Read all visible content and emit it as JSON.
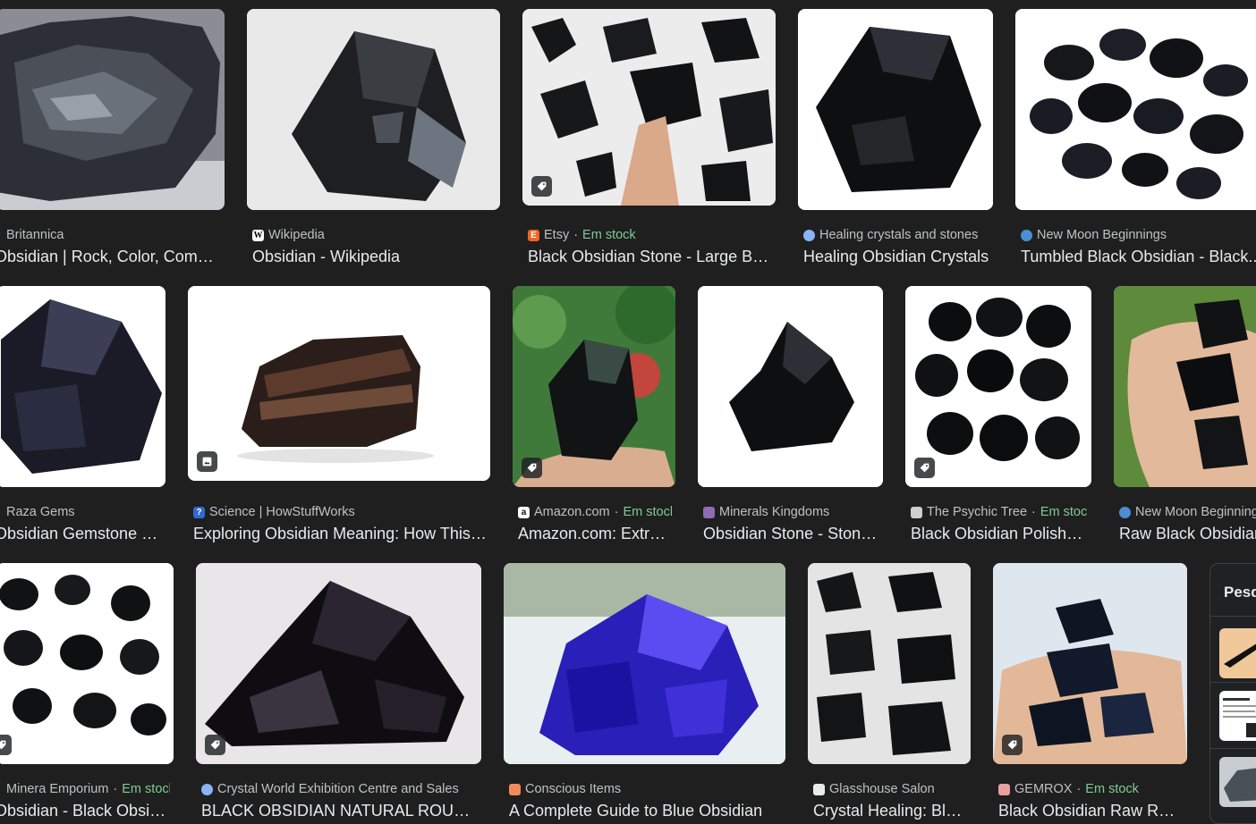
{
  "results": [
    {
      "source": "Britannica",
      "title": "Obsidian | Rock, Color, Composition...",
      "stock": "",
      "tag": false,
      "favicon": "",
      "favicon_color": "#1a73e8",
      "image": "dark-rock-outcrop"
    },
    {
      "source": "Wikipedia",
      "title": "Obsidian - Wikipedia",
      "stock": "",
      "tag": false,
      "favicon": "W",
      "favicon_color": "#ffffff",
      "image": "obsidian-chunk"
    },
    {
      "source": "Etsy",
      "title": "Black Obsidian Stone - Large Black Obsidian",
      "stock": "Em stock",
      "tag": true,
      "favicon": "E",
      "favicon_color": "#f1641e",
      "image": "obsidian-pieces-hand"
    },
    {
      "source": "Healing crystals and stones",
      "title": "Healing Obsidian Crystals",
      "stock": "",
      "tag": false,
      "favicon": "",
      "favicon_color": "#8ab4f8",
      "image": "obsidian-chunk"
    },
    {
      "source": "New Moon Beginnings",
      "title": "Tumbled Black Obsidian - Black...",
      "stock": "",
      "tag": false,
      "favicon": "",
      "favicon_color": "#4a8fd1",
      "image": "tumbled-stones"
    },
    {
      "source": "Raza Gems",
      "title": "Obsidian Gemstone Meaning",
      "stock": "",
      "tag": false,
      "favicon": "",
      "favicon_color": "#777777",
      "image": "obsidian-chunk"
    },
    {
      "source": "Science | HowStuffWorks",
      "title": "Exploring Obsidian Meaning: How This Volcanic Glass",
      "stock": "",
      "tag": true,
      "favicon": "?",
      "favicon_color": "#3367d6",
      "image": "mahogany-obsidian"
    },
    {
      "source": "Amazon.com",
      "title": "Amazon.com: Extra Large Obsidian",
      "stock": "Em stock",
      "tag": true,
      "favicon": "a",
      "favicon_color": "#ffffff",
      "image": "obsidian-hand-garden"
    },
    {
      "source": "Minerals Kingdoms",
      "title": "Obsidian Stone - Stone Properties",
      "stock": "",
      "tag": false,
      "favicon": "",
      "favicon_color": "#8e6cb2",
      "image": "obsidian-chunk"
    },
    {
      "source": "The Psychic Tree",
      "title": "Black Obsidian Polished Tumble",
      "stock": "Em stock",
      "tag": true,
      "favicon": "",
      "favicon_color": "#cfcfcf",
      "image": "tumbled-stones"
    },
    {
      "source": "New Moon Beginnings",
      "title": "Raw Black Obsidian",
      "stock": "",
      "tag": false,
      "favicon": "",
      "favicon_color": "#4a8fd1",
      "image": "obsidian-hand-garden"
    },
    {
      "source": "Minera Emporium",
      "title": "Obsidian - Black Obsidian Tumbled",
      "stock": "Em stock",
      "tag": true,
      "favicon": "",
      "favicon_color": "#cfcfcf",
      "image": "tumbled-stones"
    },
    {
      "source": "Crystal World Exhibition Centre and Sales",
      "title": "BLACK OBSIDIAN NATURAL ROUGH",
      "stock": "",
      "tag": true,
      "favicon": "",
      "favicon_color": "#8ab4f8",
      "image": "obsidian-chunk"
    },
    {
      "source": "Conscious Items",
      "title": "A Complete Guide to Blue Obsidian",
      "stock": "",
      "tag": false,
      "favicon": "",
      "favicon_color": "#f28b5c",
      "image": "blue-obsidian"
    },
    {
      "source": "Glasshouse Salon",
      "title": "Crystal Healing: Black Obsidian",
      "stock": "",
      "tag": false,
      "favicon": "",
      "favicon_color": "#e8eaed",
      "image": "obsidian-pieces"
    },
    {
      "source": "GEMROX",
      "title": "Black Obsidian Raw Rough",
      "stock": "Em stock",
      "tag": true,
      "favicon": "",
      "favicon_color": "#e8a0a0",
      "image": "obsidian-hand-garden"
    }
  ],
  "side_panel": {
    "title": "Pesquisas relacionadas"
  },
  "separator": " · "
}
